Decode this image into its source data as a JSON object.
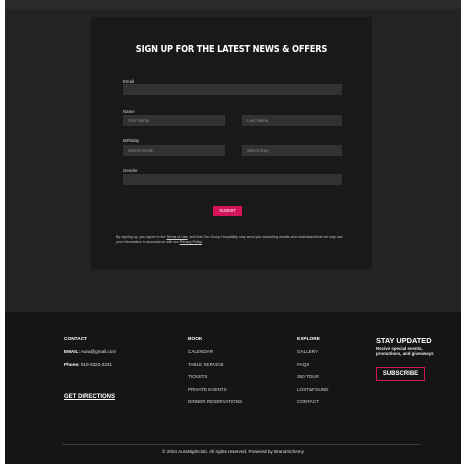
{
  "signup": {
    "title": "SIGN UP FOR THE LATEST NEWS & OFFERS",
    "email_label": "Email",
    "email_value": "",
    "name_label": "Name",
    "first_name_placeholder": "First Name",
    "last_name_placeholder": "Last Name",
    "birthday_label": "Birthday",
    "month_placeholder": "Select Month",
    "day_placeholder": "Select Day",
    "gender_label": "Gender",
    "gender_value": "",
    "submit_label": "SUBMIT",
    "legal_before": "By signing up, you agree to the ",
    "terms_link": "Terms of Use",
    "legal_middle": ", and that Tao Group Hospitality may send you marketing emails and understand that we may use your information in accordance with our ",
    "privacy_link": "Privacy Policy",
    "legal_after": "."
  },
  "footer": {
    "contact": {
      "heading": "CONTACT",
      "email_label": "EMAIL:",
      "email_value": " Aura@gmail.com",
      "phone_label": "Phone:",
      "phone_value": " 010-3323-2231",
      "directions": "GET DIRECTIONS"
    },
    "book": {
      "heading": "BOOK",
      "links": [
        "CALENDAR",
        "TABLE SERVICE",
        "TICKETS",
        "PRIVATE EVENTS",
        "DINNER RESERVATIONS"
      ]
    },
    "explore": {
      "heading": "EXPLORE",
      "links": [
        "GALLERY",
        "FAQS",
        "360 TOUR",
        "LOST&FOUND",
        "CONTACT"
      ]
    },
    "stay": {
      "title": "STAY UPDATED",
      "subtitle": "Recive special events, promotions, and giveaways",
      "button": "SUBSCRIBE"
    },
    "copyright": "© 2024 AuraNightclub. All rights reserved. Powered by BrandAlchemy"
  },
  "colors": {
    "page_bg": "#232323",
    "card_bg": "#191919",
    "field_bg": "#323232",
    "footer_bg": "#151515",
    "accent": "#d4145a"
  }
}
